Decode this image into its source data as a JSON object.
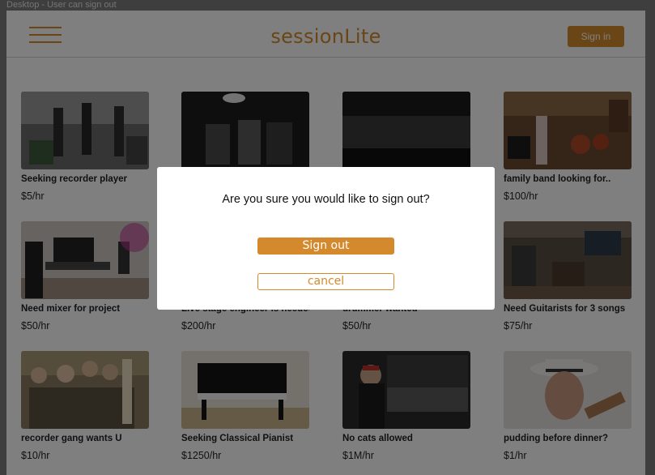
{
  "frame": {
    "label": "Desktop - User can sign out"
  },
  "header": {
    "logo": "sessionLite",
    "signin_label": "Sign in"
  },
  "colors": {
    "accent": "#d48a2c"
  },
  "listings": [
    {
      "title": "Seeking recorder player",
      "price": "$5/hr"
    },
    {
      "title": "",
      "price": ""
    },
    {
      "title": "",
      "price": ""
    },
    {
      "title": "family band looking for..",
      "price": "$100/hr"
    },
    {
      "title": "Need mixer for project",
      "price": "$50/hr"
    },
    {
      "title": "Live stage engineer is needed..",
      "price": "$200/hr"
    },
    {
      "title": "drummer wanted",
      "price": "$50/hr"
    },
    {
      "title": "Need Guitarists for 3 songs",
      "price": "$75/hr"
    },
    {
      "title": "recorder gang wants U",
      "price": "$10/hr"
    },
    {
      "title": "Seeking Classical Pianist",
      "price": "$1250/hr"
    },
    {
      "title": "No cats allowed",
      "price": "$1M/hr"
    },
    {
      "title": "pudding before dinner?",
      "price": "$1/hr"
    }
  ],
  "modal": {
    "question": "Are you sure you would like to sign out?",
    "confirm_label": "Sign out",
    "cancel_label": "cancel"
  }
}
